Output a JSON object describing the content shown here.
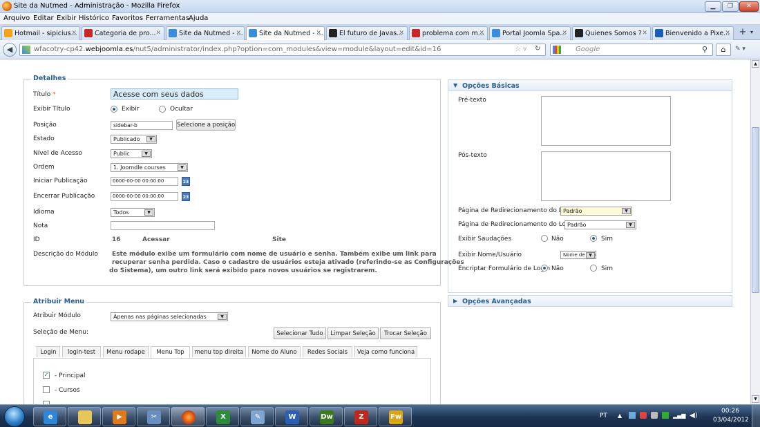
{
  "window": {
    "title": "Site da Nutmed - Administração - Mozilla Firefox"
  },
  "menu": [
    "Arquivo",
    "Editar",
    "Exibir",
    "Histórico",
    "Favoritos",
    "Ferramentas",
    "Ajuda"
  ],
  "tabs": [
    {
      "label": "Hotmail - sipicius...",
      "fav": "#f7a21b"
    },
    {
      "label": "Categoria de pro...",
      "fav": "#c62828"
    },
    {
      "label": "Site da Nutmed - ...",
      "fav": "#3b8dd8"
    },
    {
      "label": "Site da Nutmed - ...",
      "fav": "#3b8dd8"
    },
    {
      "label": "El futuro de Javas...",
      "fav": "#222"
    },
    {
      "label": "problema com m...",
      "fav": "#c62828"
    },
    {
      "label": "Portal Joomla Spa...",
      "fav": "#3b8dd8"
    },
    {
      "label": "Quienes Somos ?",
      "fav": "#222"
    },
    {
      "label": "Bienvenido a Pixe...",
      "fav": "#1a5fb4"
    }
  ],
  "nav": {
    "url_prefix": "wfacotry-cp42.",
    "url_domain": "webjoomla.es",
    "url_rest": "/nut5/administrator/index.php?option=com_modules&view=module&layout=edit&id=16",
    "search_placeholder": "Google"
  },
  "detalhes": {
    "legend": "Detalhes",
    "titulo_label": "Título",
    "required_mark": "*",
    "titulo_value": "Acesse com seus dados",
    "exibir_titulo_label": "Exibir Título",
    "exibir": "Exibir",
    "ocultar": "Ocultar",
    "posicao_label": "Posição",
    "posicao_value": "sidebar-b",
    "posicao_button": "Selecione a posição",
    "estado_label": "Estado",
    "estado_value": "Publicado",
    "nivel_label": "Nível de Acesso",
    "nivel_value": "Public",
    "ordem_label": "Ordem",
    "ordem_value": "1. Joomdle courses",
    "iniciar_label": "Iniciar Publicação",
    "iniciar_value": "0000-00-00 00:00:00",
    "encerrar_label": "Encerrar Publicação",
    "encerrar_value": "0000-00-00 00:00:00",
    "cal_icon": "23",
    "idioma_label": "Idioma",
    "idioma_value": "Todos",
    "nota_label": "Nota",
    "nota_value": "",
    "id_label": "ID",
    "id_value": "16",
    "id_name": "Acessar",
    "id_site": "Site",
    "descricao_label": "Descrição do Módulo",
    "descricao_line1": "Este módulo exibe um formulário com nome de usuário e senha. Também exibe um link para",
    "descricao_line2": "recuperar senha perdida. Caso o cadastro de usuários esteja ativado (referindo-se as Configurações",
    "descricao_line3": "do Sistema), um outro link será exibido para novos usuários se registrarem."
  },
  "basicas": {
    "header": "Opções Básicas",
    "pretexto": "Pré-texto",
    "postexto": "Pós-texto",
    "redir_login": "Página de Redirecionamento do Login",
    "redir_login_value": "Padrão",
    "redir_logout": "Página de Redirecionamento do Logout",
    "redir_logout_value": "Padrão",
    "saudacoes": "Exibir Saudações",
    "nao": "Não",
    "sim": "Sim",
    "nome_usuario": "Exibir Nome/Usuário",
    "nome_usuario_value": "Nome de Usuário",
    "encriptar": "Encriptar Formulário de Login"
  },
  "avancadas": {
    "header": "Opções Avançadas"
  },
  "atribuir": {
    "legend": "Atribuir Menu",
    "modulo_label": "Atribuir Módulo",
    "modulo_value": "Apenas nas páginas selecionadas",
    "selecao_label": "Seleção de Menu:",
    "btn_all": "Selecionar Tudo",
    "btn_clear": "Limpar Seleção",
    "btn_toggle": "Trocar Seleção",
    "tabs": [
      "Login",
      "login-test",
      "Menu rodape",
      "Menu Top",
      "menu top direita",
      "Nome do Aluno",
      "Redes Sociais",
      "Veja como funciona"
    ],
    "items": [
      "- Principal",
      "- Cursos"
    ]
  },
  "tray": {
    "lang": "PT",
    "time": "00:26",
    "date": "03/04/2012"
  }
}
